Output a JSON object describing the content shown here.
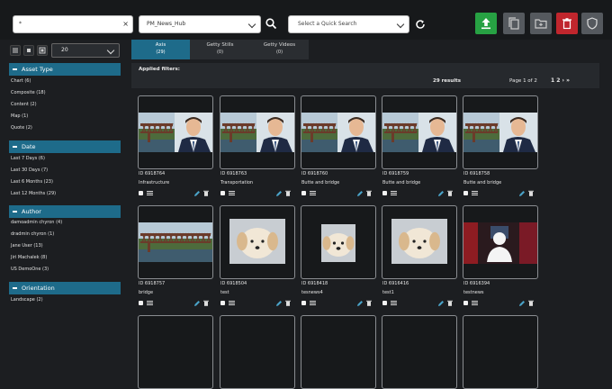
{
  "toolbar": {
    "search_value": "*",
    "folder_value": "PM_News_Hub",
    "quick_search_placeholder": "Select a Quick Search",
    "colors": {
      "upload": "#27a143",
      "delete": "#c0262d",
      "neutral": "#55595e"
    }
  },
  "view": {
    "per_page": "20"
  },
  "facets": [
    {
      "title": "Asset Type",
      "items": [
        "Chart (6)",
        "Composite (18)",
        "Content (2)",
        "Map (1)",
        "Quote (2)"
      ]
    },
    {
      "title": "Date",
      "items": [
        "Last 7 Days (6)",
        "Last 30 Days (7)",
        "Last 6 Months (23)",
        "Last 12 Months (29)"
      ]
    },
    {
      "title": "Author",
      "items": [
        "damoadmin chyron (4)",
        "dradmin chyron (1)",
        "Jane User (13)",
        "Jiri Machalek (8)",
        "US DemoOne (3)"
      ]
    },
    {
      "title": "Orientation",
      "items": [
        "Landscape (2)"
      ]
    }
  ],
  "tabs": [
    {
      "label": "Axis",
      "count": "(29)"
    },
    {
      "label": "Getty Stills",
      "count": "(0)"
    },
    {
      "label": "Getty Videos",
      "count": "(0)"
    }
  ],
  "results": {
    "applied_filters": "Applied filters:",
    "count": "29 results",
    "page_info": "Page 1 of 2",
    "pages": "1 2"
  },
  "assets": [
    {
      "id": "ID 6918764",
      "title": "Infrastructure",
      "thumb": "bridge-portrait"
    },
    {
      "id": "ID 6918763",
      "title": "Transportation",
      "thumb": "bridge-portrait"
    },
    {
      "id": "ID 6918760",
      "title": "Butte and bridge",
      "thumb": "bridge-portrait"
    },
    {
      "id": "ID 6918759",
      "title": "Butte and bridge",
      "thumb": "bridge-portrait"
    },
    {
      "id": "ID 6918758",
      "title": "Butte and bridge",
      "thumb": "bridge-portrait"
    },
    {
      "id": "ID 6918757",
      "title": "bridge",
      "thumb": "bridge"
    },
    {
      "id": "ID 6918504",
      "title": "test",
      "thumb": "dog"
    },
    {
      "id": "ID 6918418",
      "title": "tesnews4",
      "thumb": "dog-small"
    },
    {
      "id": "ID 6916416",
      "title": "test1",
      "thumb": "dog"
    },
    {
      "id": "ID 6916394",
      "title": "testnews",
      "thumb": "silhouette"
    }
  ]
}
